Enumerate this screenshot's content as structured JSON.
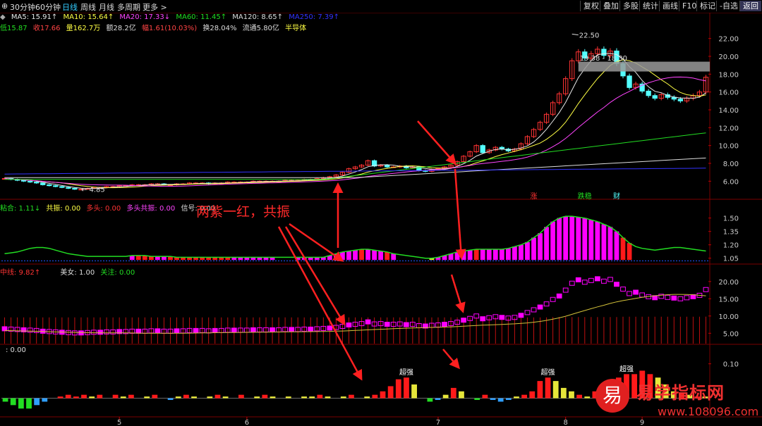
{
  "toolbar": {
    "periods": [
      "30分钟",
      "60分钟",
      "日线",
      "周线",
      "月线",
      "多周期",
      "更多 >"
    ],
    "active_period": "日线",
    "buttons": [
      "复权",
      "叠加",
      "多股",
      "统计",
      "画线",
      "F10",
      "标记",
      "-自选",
      "返回"
    ],
    "highlight_button": "返回"
  },
  "main_legend": {
    "ma": [
      {
        "label": "MA5: 15.91↑",
        "color": "#e8e8e8"
      },
      {
        "label": "MA10: 15.64↑",
        "color": "#ffff44"
      },
      {
        "label": "MA20: 17.33↓",
        "color": "#ff44ff"
      },
      {
        "label": "MA60: 11.45↑",
        "color": "#22dd22"
      },
      {
        "label": "MA120: 8.65↑",
        "color": "#dddddd"
      },
      {
        "label": "MA250: 7.39↑",
        "color": "#3333ff"
      }
    ],
    "info": [
      {
        "label": "低15.87",
        "color": "#22dd22"
      },
      {
        "label": "收17.66",
        "color": "#ff4444"
      },
      {
        "label": "量162.7万",
        "color": "#ffff44"
      },
      {
        "label": "额28.2亿",
        "color": "#dddddd"
      },
      {
        "label": "幅1.61(10.03%)",
        "color": "#ff4444"
      },
      {
        "label": "换28.04%",
        "color": "#dddddd"
      },
      {
        "label": "流通5.80亿",
        "color": "#dddddd"
      },
      {
        "label": "半导体",
        "color": "#ffff44"
      }
    ]
  },
  "sub1_legend": [
    {
      "label": "粘合: 1.11↓",
      "color": "#22dd22"
    },
    {
      "label": "共振: 0.00",
      "color": "#ffff44"
    },
    {
      "label": "多头: 0.00",
      "color": "#ff3333"
    },
    {
      "label": "多头共振: 0.00",
      "color": "#ff44ff"
    },
    {
      "label": "信号: 0.00",
      "color": "#dddddd"
    }
  ],
  "sub2_legend": [
    {
      "label": "中线: 9.82↑",
      "color": "#ff3333"
    },
    {
      "label": "美女: 1.00",
      "color": "#dddddd"
    },
    {
      "label": "关注: 0.00",
      "color": "#22dd22"
    }
  ],
  "sub3_legend": [
    {
      "label": ": 0.00",
      "color": "#dddddd"
    }
  ],
  "annotation": "两紫一红，共振",
  "logo": {
    "char": "易",
    "name": "易学指标网",
    "url": "www.108096.com"
  },
  "colors": {
    "up": "#ff3333",
    "down": "#54ffff",
    "magenta": "#ff00ff",
    "red": "#ff1a1a",
    "yellow": "#e6e63a",
    "green": "#22dd22",
    "arrow": "#ff2020"
  },
  "chart_data": [
    {
      "type": "candlestick",
      "name": "main",
      "ylim": [
        5,
        23
      ],
      "y_ticks": [
        6,
        8,
        10,
        12,
        14,
        16,
        18,
        20,
        22
      ],
      "x_ticks": [
        "5",
        "6",
        "7",
        "8",
        "9"
      ],
      "annotations": [
        "22.50",
        "19.38 - 18.30",
        "4.85"
      ],
      "markers": [
        {
          "label": "涨",
          "color": "#ff3333"
        },
        {
          "label": "跌稳",
          "color": "#22dd22"
        },
        {
          "label": "财",
          "color": "#54ffff"
        }
      ],
      "close": [
        6.3,
        6.2,
        6.1,
        6.0,
        5.9,
        5.8,
        5.6,
        5.5,
        5.4,
        5.3,
        5.2,
        5.1,
        5.1,
        5.2,
        5.3,
        5.3,
        5.4,
        5.4,
        5.5,
        5.5,
        5.6,
        5.6,
        5.6,
        5.7,
        5.7,
        5.6,
        5.6,
        5.7,
        5.7,
        5.8,
        5.8,
        5.8,
        5.7,
        5.8,
        5.8,
        5.9,
        5.9,
        5.9,
        5.9,
        6.0,
        6.0,
        6.0,
        6.0,
        6.0,
        6.1,
        6.1,
        6.1,
        6.2,
        6.2,
        6.3,
        6.4,
        6.5,
        6.7,
        7.0,
        7.4,
        7.6,
        7.8,
        8.3,
        7.7,
        7.8,
        7.6,
        7.6,
        7.7,
        7.5,
        7.6,
        7.2,
        7.1,
        7.3,
        7.4,
        7.6,
        7.8,
        8.2,
        8.8,
        9.3,
        10.0,
        9.2,
        9.5,
        9.8,
        9.6,
        9.4,
        9.6,
        10.2,
        11.0,
        11.8,
        12.6,
        13.5,
        14.8,
        15.8,
        17.5,
        19.5,
        20.5,
        19.8,
        20.3,
        20.8,
        20.1,
        20.6,
        19.2,
        17.8,
        16.5,
        16.9,
        16.1,
        15.6,
        15.3,
        15.7,
        15.4,
        15.2,
        15.0,
        15.3,
        15.6,
        16.0,
        17.66
      ],
      "series": [
        {
          "name": "MA5",
          "color": "#e8e8e8"
        },
        {
          "name": "MA10",
          "color": "#ffff44"
        },
        {
          "name": "MA20",
          "color": "#ff44ff"
        },
        {
          "name": "MA60",
          "color": "#22dd22"
        },
        {
          "name": "MA120",
          "color": "#dddddd"
        },
        {
          "name": "MA250",
          "color": "#3333ff"
        }
      ]
    },
    {
      "type": "bar",
      "name": "resonance",
      "ylim": [
        1.0,
        1.6
      ],
      "y_ticks": [
        1.05,
        1.2,
        1.35,
        1.5
      ],
      "values": [
        1.1,
        1.11,
        1.12,
        1.14,
        1.16,
        1.17,
        1.17,
        1.16,
        1.14,
        1.12,
        1.1,
        1.09,
        1.08,
        1.07,
        1.07,
        1.07,
        1.07,
        1.07,
        1.07,
        1.07,
        1.08,
        1.08,
        1.08,
        1.07,
        1.07,
        1.07,
        1.07,
        1.06,
        1.06,
        1.06,
        1.06,
        1.06,
        1.06,
        1.06,
        1.06,
        1.06,
        1.06,
        1.06,
        1.06,
        1.06,
        1.06,
        1.06,
        1.06,
        1.06,
        1.06,
        1.06,
        1.06,
        1.06,
        1.06,
        1.06,
        1.06,
        1.08,
        1.1,
        1.12,
        1.13,
        1.14,
        1.15,
        1.15,
        1.14,
        1.13,
        1.12,
        1.1,
        1.09,
        1.08,
        1.07,
        1.06,
        1.05,
        1.05,
        1.06,
        1.08,
        1.1,
        1.12,
        1.13,
        1.14,
        1.15,
        1.15,
        1.15,
        1.15,
        1.15,
        1.16,
        1.18,
        1.2,
        1.23,
        1.28,
        1.33,
        1.4,
        1.46,
        1.5,
        1.52,
        1.52,
        1.51,
        1.5,
        1.48,
        1.46,
        1.43,
        1.4,
        1.35,
        1.28,
        1.22,
        1.18,
        1.16,
        1.15,
        1.14,
        1.15,
        1.16,
        1.17,
        1.17,
        1.16,
        1.15,
        1.14,
        1.13
      ],
      "colors": [
        "",
        "",
        "",
        "",
        "",
        "",
        "",
        "",
        "",
        "",
        "",
        "",
        "",
        "",
        "",
        "",
        "",
        "",
        "",
        "",
        "m",
        "r",
        "r",
        "r",
        "m",
        "m",
        "r",
        "r",
        "r",
        "r",
        "r",
        "r",
        "r",
        "r",
        "r",
        "r",
        "m",
        "m",
        "m",
        "m",
        "m",
        "m",
        "m",
        "",
        "",
        "",
        "m",
        "m",
        "m",
        "m",
        "m",
        "m",
        "m",
        "m",
        "m",
        "m",
        "r",
        "m",
        "m",
        "m",
        "r",
        "m",
        "",
        "",
        "",
        "",
        "",
        "y",
        "m",
        "m",
        "m",
        "m",
        "m",
        "m",
        "r",
        "m",
        "m",
        "m",
        "m",
        "m",
        "m",
        "m",
        "m",
        "m",
        "m",
        "m",
        "m",
        "m",
        "m",
        "m",
        "m",
        "m",
        "m",
        "m",
        "m",
        "m",
        "m",
        "r",
        "r",
        "",
        "",
        "",
        "",
        "",
        "",
        "",
        "",
        "",
        "",
        ""
      ]
    },
    {
      "type": "bar",
      "name": "middle_line",
      "ylim": [
        2,
        22
      ],
      "y_ticks": [
        5,
        10,
        15,
        20
      ],
      "bars": [
        9.6,
        9.6,
        9.6,
        9.6,
        9.6,
        9.6,
        9.6,
        9.6,
        9.6,
        9.6,
        9.6,
        9.6,
        9.6,
        9.6,
        9.6,
        9.6,
        9.6,
        9.6,
        9.6,
        9.6,
        9.6,
        9.6,
        9.6,
        9.6,
        9.6,
        9.6,
        9.6,
        9.6,
        9.6,
        9.6,
        9.6,
        9.6,
        9.6,
        9.6,
        9.6,
        9.6,
        9.6,
        9.6,
        9.6,
        9.6,
        9.6,
        9.6,
        9.6,
        9.6,
        9.6,
        9.6,
        9.6,
        9.6,
        9.6,
        9.6,
        9.6,
        9.6,
        9.6,
        9.6,
        9.6,
        9.6,
        9.6,
        9.6,
        9.6,
        9.6,
        9.6,
        9.6,
        9.6,
        9.6,
        9.6,
        9.6,
        9.6,
        9.6,
        9.6,
        9.6,
        9.6,
        9.6,
        9.6,
        9.6,
        9.6,
        9.6,
        9.6,
        9.6,
        9.6,
        9.6,
        9.6,
        9.6,
        9.6,
        9.6,
        9.6,
        9.6,
        9.7,
        9.7,
        9.7,
        9.7,
        9.7,
        9.7,
        9.7,
        9.7,
        9.7,
        9.7,
        9.7,
        9.8,
        9.8,
        9.8,
        9.8,
        9.8,
        9.8,
        9.8,
        9.8,
        9.8,
        9.8,
        9.8,
        9.8,
        9.8,
        9.82
      ]
    },
    {
      "type": "bar",
      "name": "momentum",
      "ylim": [
        -0.05,
        0.13
      ],
      "y_ticks": [
        0.1
      ],
      "labels": [
        "超强",
        "超强",
        "超强"
      ],
      "values": [
        -0.01,
        -0.02,
        -0.03,
        -0.03,
        -0.02,
        -0.01,
        0.0,
        0.005,
        0.01,
        0.005,
        0.01,
        0.005,
        0.01,
        0.0,
        0.01,
        0.005,
        0.01,
        0.0,
        0.005,
        0.01,
        0.0,
        -0.005,
        0.005,
        0.01,
        0.005,
        0.0,
        0.005,
        0.01,
        0.005,
        0.0,
        0.01,
        0.0,
        0.005,
        0.01,
        0.005,
        0.0,
        0.005,
        0.0,
        0.005,
        0.005,
        0.01,
        0.005,
        0.0,
        0.005,
        0.01,
        0.0,
        0.005,
        0.01,
        0.02,
        0.035,
        0.055,
        0.06,
        0.04,
        0.0,
        -0.01,
        -0.005,
        0.01,
        0.03,
        0.02,
        0.0,
        -0.005,
        0.01,
        -0.005,
        -0.01,
        -0.005,
        0.005,
        0.01,
        0.02,
        0.05,
        0.06,
        0.05,
        0.03,
        0.02,
        0.01,
        0.005,
        0.02,
        0.03,
        0.04,
        0.06,
        0.07,
        0.07,
        0.08,
        0.07,
        0.06,
        0.04,
        0.02,
        0.015,
        0.01,
        0.005,
        0.005
      ],
      "colors": [
        "g",
        "g",
        "g",
        "g",
        "c",
        "c",
        "",
        "r",
        "r",
        "r",
        "r",
        "y",
        "r",
        "",
        "r",
        "y",
        "r",
        "",
        "y",
        "r",
        "",
        "c",
        "y",
        "r",
        "y",
        "",
        "y",
        "r",
        "y",
        "",
        "r",
        "",
        "y",
        "r",
        "y",
        "",
        "y",
        "",
        "y",
        "y",
        "r",
        "y",
        "",
        "y",
        "r",
        "",
        "y",
        "r",
        "r",
        "r",
        "r",
        "r",
        "y",
        "",
        "g",
        "c",
        "y",
        "r",
        "y",
        "",
        "g",
        "r",
        "c",
        "c",
        "c",
        "y",
        "r",
        "r",
        "r",
        "r",
        "y",
        "y",
        "y",
        "r",
        "y",
        "r",
        "r",
        "r",
        "r",
        "r",
        "r",
        "r",
        "r",
        "y",
        "y",
        "y",
        "r",
        "y",
        "r",
        "y"
      ]
    }
  ]
}
